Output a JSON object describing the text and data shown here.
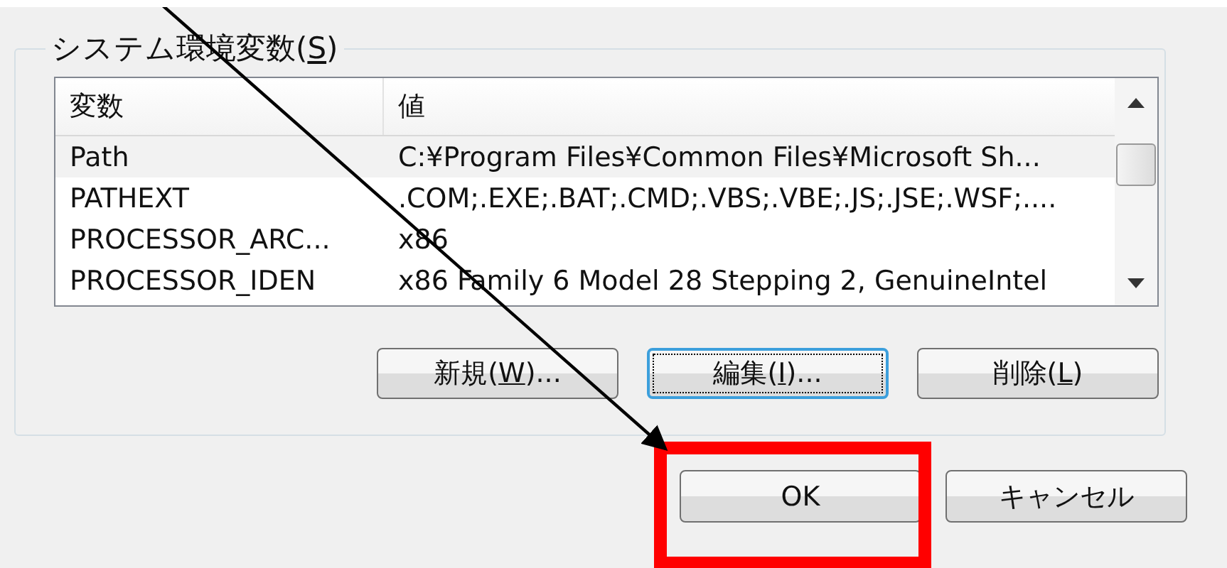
{
  "group": {
    "label_parts": [
      "システム環境変数(",
      "S",
      ")"
    ]
  },
  "table": {
    "columns": [
      "変数",
      "値"
    ],
    "rows": [
      {
        "name": "Path",
        "value": "C:¥Program Files¥Common Files¥Microsoft Sh...",
        "selected": true
      },
      {
        "name": "PATHEXT",
        "value": ".COM;.EXE;.BAT;.CMD;.VBS;.VBE;.JS;.JSE;.WSF;....",
        "selected": false
      },
      {
        "name": "PROCESSOR_ARC...",
        "value": "x86",
        "selected": false
      },
      {
        "name": "PROCESSOR_IDEN",
        "value": "x86 Family 6 Model 28 Stepping 2, GenuineIntel",
        "selected": false
      }
    ]
  },
  "list_buttons": [
    {
      "label_parts": [
        "新規(",
        "W",
        ")..."
      ],
      "focused": false
    },
    {
      "label_parts": [
        "編集(",
        "I",
        ")..."
      ],
      "focused": true
    },
    {
      "label_parts": [
        "削除(",
        "L",
        ")"
      ],
      "focused": false
    }
  ],
  "dialog_buttons": [
    {
      "label": "OK",
      "highlighted": true
    },
    {
      "label": "キャンセル",
      "highlighted": false
    }
  ]
}
